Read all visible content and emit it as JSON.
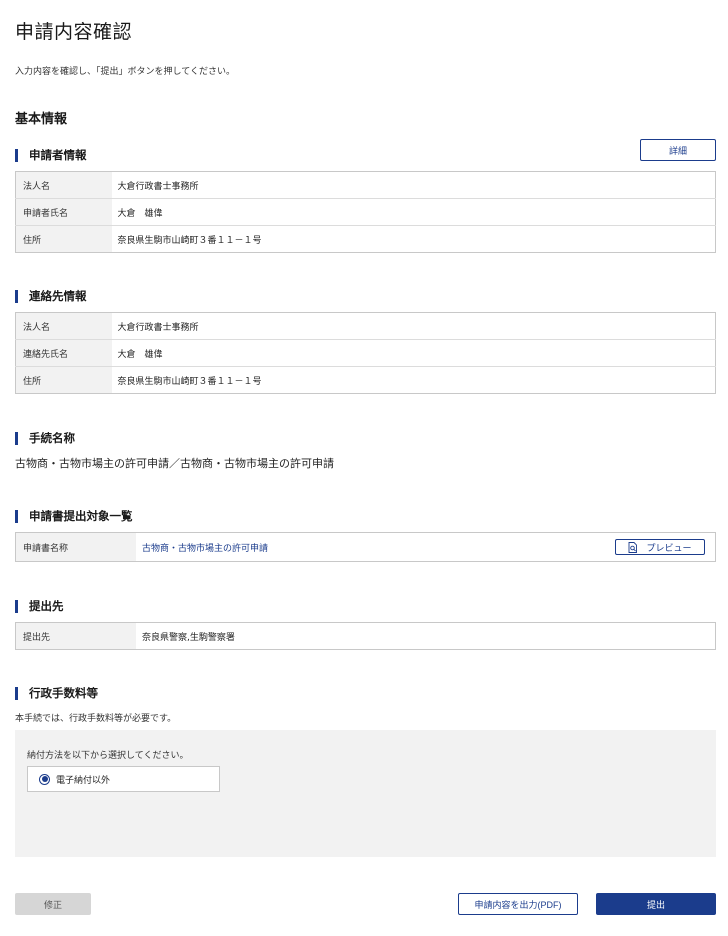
{
  "page": {
    "title": "申請内容確認",
    "intro": "入力内容を確認し、「提出」ボタンを押してください。"
  },
  "basic": {
    "title": "基本情報"
  },
  "applicant": {
    "title": "申請者情報",
    "detail_label": "詳細",
    "rows": [
      {
        "label": "法人名",
        "value": "大倉行政書士事務所"
      },
      {
        "label": "申請者氏名",
        "value": "大倉　雄偉"
      },
      {
        "label": "住所",
        "value": "奈良県生駒市山崎町３番１１－１号"
      }
    ]
  },
  "contact": {
    "title": "連絡先情報",
    "rows": [
      {
        "label": "法人名",
        "value": "大倉行政書士事務所"
      },
      {
        "label": "連絡先氏名",
        "value": "大倉　雄偉"
      },
      {
        "label": "住所",
        "value": "奈良県生駒市山崎町３番１１－１号"
      }
    ]
  },
  "procedure": {
    "title": "手続名称",
    "name": "古物商・古物市場主の許可申請／古物商・古物市場主の許可申請"
  },
  "documents": {
    "title": "申請書提出対象一覧",
    "label": "申請書名称",
    "name": "古物商・古物市場主の許可申請",
    "preview_label": "プレビュー"
  },
  "destination": {
    "title": "提出先",
    "label": "提出先",
    "value": "奈良県警察,生駒警察署"
  },
  "fee": {
    "title": "行政手数料等",
    "note": "本手続では、行政手数料等が必要です。",
    "method_label": "納付方法を以下から選択してください。",
    "option_selected": "電子納付以外"
  },
  "actions": {
    "fix_label": "修正",
    "pdf_label": "申請内容を出力(PDF)",
    "submit_label": "提出"
  },
  "colors": {
    "accent": "#1b3c8c",
    "header_cell": "#f2f2f2",
    "panel": "#f2f2f2"
  }
}
